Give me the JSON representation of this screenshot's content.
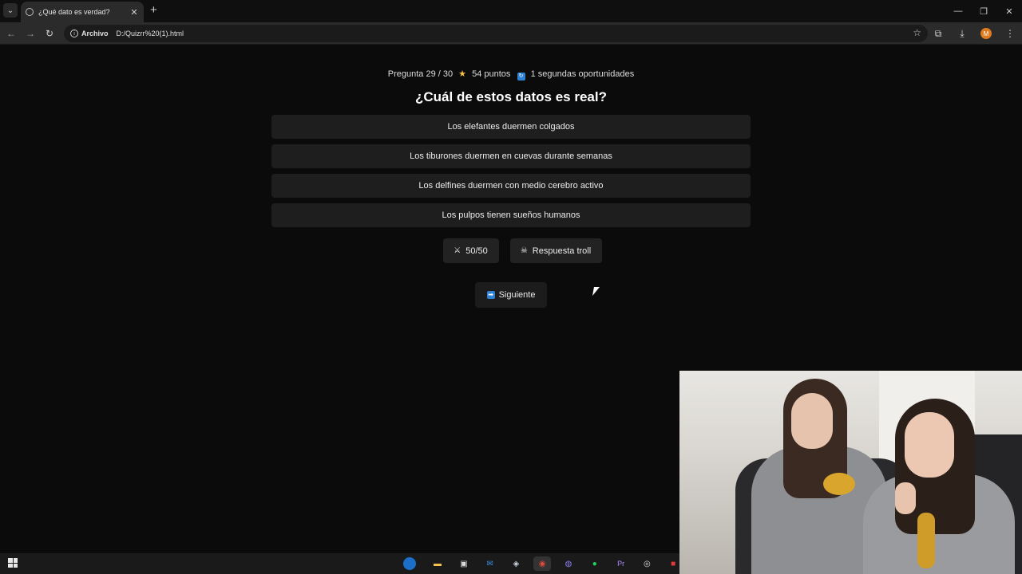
{
  "browser": {
    "tab_title": "¿Qué dato es verdad?",
    "address_scheme": "Archivo",
    "address_url": "D:/Quizrr%20(1).html",
    "profile_initial": "M"
  },
  "quiz": {
    "status": {
      "question_progress": "Pregunta 29 / 30",
      "points": "54 puntos",
      "second_chances": "1 segundas oportunidades"
    },
    "question": "¿Cuál de estos datos es real?",
    "answers": [
      "Los elefantes duermen colgados",
      "Los tiburones duermen en cuevas durante semanas",
      "Los delfines duermen con medio cerebro activo",
      "Los pulpos tienen sueños humanos"
    ],
    "powerups": {
      "fifty_label": "50/50",
      "troll_label": "Respuesta troll"
    },
    "next_label": "Siguiente"
  },
  "colors": {
    "page_bg": "#0b0b0b",
    "answer_bg": "#1e1e1e",
    "star": "#f5c242",
    "accent_blue": "#2f80d1",
    "profile_orange": "#e07a1f"
  },
  "icons": {
    "points": "star-icon",
    "second_chances": "retry-icon",
    "fifty": "crossed-swords-icon",
    "troll": "skull-icon",
    "next": "arrow-right-icon"
  },
  "taskbar": {
    "apps": [
      "edge-icon",
      "file-explorer-icon",
      "store-icon",
      "mail-icon",
      "steam-icon",
      "chrome-icon",
      "discord-icon",
      "spotify-icon",
      "premiere-icon",
      "obs-icon",
      "app-red-icon"
    ]
  }
}
